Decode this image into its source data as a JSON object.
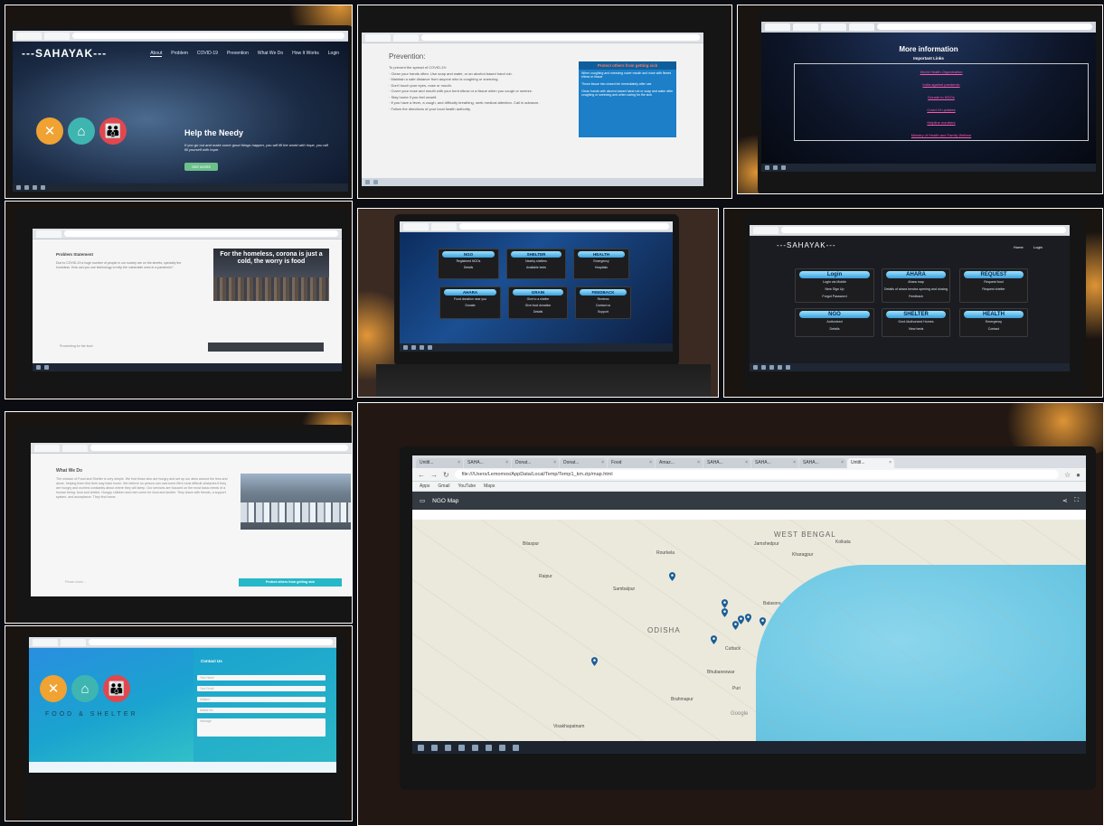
{
  "home": {
    "brand": "---SAHAYAK---",
    "nav": [
      "About",
      "Problem",
      "COVID-19",
      "Prevention",
      "What We Do",
      "How It Works",
      "Login"
    ],
    "help_title": "Help the Needy",
    "quote": "If you go out and make some good things happen, you will fill the world with hope, you will fill yourself with hope.",
    "button": "SEE MORE",
    "caption": "FOOD & SHELTER"
  },
  "prevention": {
    "title": "Prevention:",
    "items": [
      "To prevent the spread of COVID-19:",
      "· Clean your hands often. Use soap and water, or an alcohol-based hand rub.",
      "· Maintain a safe distance from anyone who is coughing or sneezing.",
      "· Don't touch your eyes, nose or mouth.",
      "· Cover your nose and mouth with your bent elbow or a tissue when you cough or sneeze.",
      "· Stay home if you feel unwell.",
      "· If you have a fever, a cough, and difficulty breathing, seek medical attention. Call in advance.",
      "· Follow the directions of your local health authority."
    ],
    "poster_title": "Protect others from getting sick",
    "poster_rows": [
      "When coughing and sneezing cover mouth and nose with flexed elbow or tissue",
      "Throw tissue into closed bin immediately after use",
      "Clean hands with alcohol-based hand rub or soap and water after coughing or sneezing and when caring for the sick"
    ]
  },
  "info": {
    "title": "More information",
    "subtitle": "Important Links",
    "links": [
      "World Health Organization",
      "India against pandemic",
      "Donate to NGOs",
      "Covid-19 updates",
      "Helpline numbers",
      "Ministry of Health and Family Welfare"
    ]
  },
  "problem": {
    "title": "Problem Statement",
    "text": "Due to COVID-19 a huge number of people in our society are on the streets, specially the homeless. How can you use technology to help the vulnerable ones in a pandemic?",
    "headline": "For the homeless, corona is just a cold, the worry is food",
    "footer": "Proceeding for the fund"
  },
  "dashboard": {
    "cards": [
      {
        "title": "NGO",
        "items": [
          "Registered NGOs",
          "Details"
        ]
      },
      {
        "title": "SHELTER",
        "items": [
          "Nearby shelters",
          "Available beds"
        ]
      },
      {
        "title": "HEALTH",
        "items": [
          "Emergency",
          "Hospitals"
        ]
      },
      {
        "title": "AHARA",
        "items": [
          "Food donation near you",
          "Donate"
        ]
      },
      {
        "title": "GRAIN",
        "items": [
          "Give to a shelter",
          "Give food donation",
          "Details"
        ]
      },
      {
        "title": "FEEDBACK",
        "items": [
          "Reviews",
          "Contact us",
          "Support"
        ]
      }
    ]
  },
  "sahayak_dash": {
    "brand": "---SAHAYAK---",
    "nav": [
      "Home",
      "Login"
    ],
    "cards": [
      {
        "title": "Login",
        "items": [
          "Login via Mobile",
          "New Sign Up",
          "Forgot Password"
        ]
      },
      {
        "title": "AHARA",
        "items": [
          "Ahara map",
          "Details of ahara kendra opening and closing",
          "Feedback"
        ]
      },
      {
        "title": "REQUEST",
        "items": [
          "Request food",
          "Request shelter"
        ]
      },
      {
        "title": "NGO",
        "items": [
          "Authorized",
          "Details"
        ]
      },
      {
        "title": "SHELTER",
        "items": [
          "Govt./Authorized Homes",
          "View beds"
        ]
      },
      {
        "title": "HEALTH",
        "items": [
          "Emergency",
          "Contact"
        ]
      }
    ]
  },
  "what_we_do": {
    "title": "What We Do",
    "text": "The mission of Food and Shelter is very simple. We find those who are hungry and set up our aims around the less and alone, helping them find their way back home. We believe no person can overcome life's most difficult obstacles if they are hungry and worried constantly about where they will sleep. Our services are focused on the most basic needs of a human being: food and shelter. Hungry children and men come for food and shelter. They leave with friends, a support system, and acceptance. They find home.",
    "bar": "Protect others from getting sick",
    "foot": "Please share..."
  },
  "contact": {
    "title": "Contact Us",
    "fields": [
      "Your Name",
      "Your Email",
      "Subject",
      "Mobile No.",
      "Message"
    ],
    "caption": "FOOD & SHELTER"
  },
  "map": {
    "tabs": [
      "Untitl...",
      "SAHA...",
      "Donat...",
      "Donat...",
      "Food",
      "Amaz...",
      "SAHA...",
      "SAHA...",
      "SAHA...",
      "Untitl..."
    ],
    "url": "file:///Users/Lemomos/AppData/Local/Temp/Temp1_km.zip/map.html",
    "bookmarks": [
      "Apps",
      "Gmail",
      "YouTube",
      "Maps"
    ],
    "title": "NGO Map",
    "labels": {
      "west_bengal": "WEST BENGAL",
      "odisha": "ODISHA",
      "bhubaneswar": "Bhubaneswar",
      "kolkata": "Kolkata",
      "jamshedpur": "Jamshedpur",
      "rourkela": "Rourkela",
      "raipur": "Raipur",
      "puri": "Puri",
      "cuttack": "Cuttack",
      "berhampur": "Brahmapur",
      "visakhapatnam": "Visakhapatnam",
      "kharagpur": "Kharagpur",
      "balasore": "Balasore",
      "bilaspur": "Bilaspur",
      "sambalpur": "Sambalpur",
      "google": "Google"
    }
  }
}
